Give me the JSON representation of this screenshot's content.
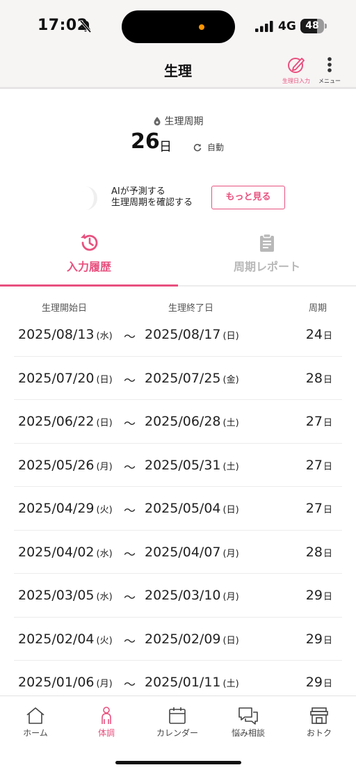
{
  "status_bar": {
    "time": "17:02",
    "network": "4G",
    "battery": "48"
  },
  "header": {
    "title": "生理",
    "input_button_label": "生理日入力",
    "menu_button_label": "メニュー"
  },
  "summary": {
    "cycle_title": "生理周期",
    "cycle_days": "26",
    "cycle_unit": "日",
    "auto_label": "自動"
  },
  "ai_prompt": {
    "line1": "AIが予測する",
    "line2": "生理周期を確認する",
    "more_button": "もっと見る"
  },
  "tabs": [
    {
      "label": "入力履歴",
      "active": true
    },
    {
      "label": "周期レポート",
      "active": false
    }
  ],
  "table": {
    "headers": [
      "生理開始日",
      "生理終了日",
      "周期"
    ],
    "tilde": "～",
    "day_unit": "日",
    "rows": [
      {
        "start": "2025/08/13",
        "start_dow": "(水)",
        "end": "2025/08/17",
        "end_dow": "(日)",
        "cycle": "24"
      },
      {
        "start": "2025/07/20",
        "start_dow": "(日)",
        "end": "2025/07/25",
        "end_dow": "(金)",
        "cycle": "28"
      },
      {
        "start": "2025/06/22",
        "start_dow": "(日)",
        "end": "2025/06/28",
        "end_dow": "(土)",
        "cycle": "27"
      },
      {
        "start": "2025/05/26",
        "start_dow": "(月)",
        "end": "2025/05/31",
        "end_dow": "(土)",
        "cycle": "27"
      },
      {
        "start": "2025/04/29",
        "start_dow": "(火)",
        "end": "2025/05/04",
        "end_dow": "(日)",
        "cycle": "27"
      },
      {
        "start": "2025/04/02",
        "start_dow": "(水)",
        "end": "2025/04/07",
        "end_dow": "(月)",
        "cycle": "28"
      },
      {
        "start": "2025/03/05",
        "start_dow": "(水)",
        "end": "2025/03/10",
        "end_dow": "(月)",
        "cycle": "29"
      },
      {
        "start": "2025/02/04",
        "start_dow": "(火)",
        "end": "2025/02/09",
        "end_dow": "(日)",
        "cycle": "29"
      },
      {
        "start": "2025/01/06",
        "start_dow": "(月)",
        "end": "2025/01/11",
        "end_dow": "(土)",
        "cycle": "29"
      }
    ]
  },
  "bottom_nav": [
    {
      "label": "ホーム",
      "icon": "home-icon",
      "active": false
    },
    {
      "label": "体調",
      "icon": "body-icon",
      "active": true
    },
    {
      "label": "カレンダー",
      "icon": "calendar-icon",
      "active": false
    },
    {
      "label": "悩み相談",
      "icon": "chat-icon",
      "active": false
    },
    {
      "label": "おトク",
      "icon": "shop-icon",
      "active": false
    }
  ],
  "colors": {
    "accent": "#e8517f",
    "inactive_tab": "#b8b8b8",
    "header_bg": "#f7f4f4"
  }
}
